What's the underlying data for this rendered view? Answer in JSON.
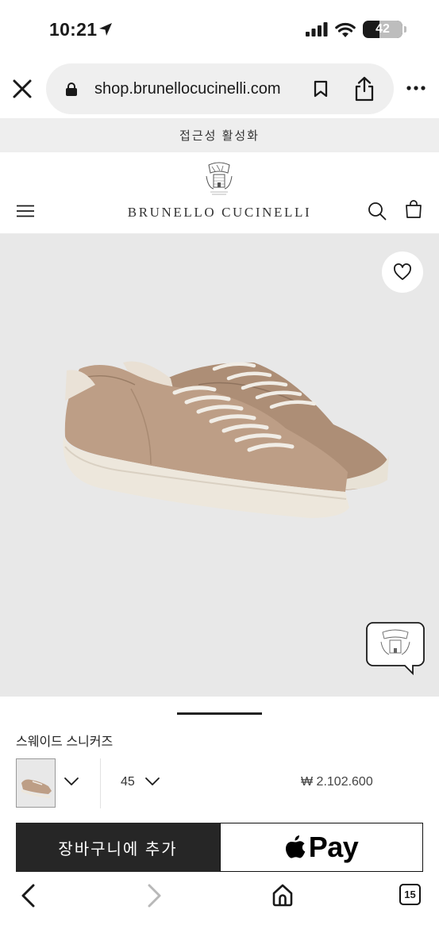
{
  "status_bar": {
    "time": "10:21",
    "battery": "42",
    "battery_level": 0.42
  },
  "browser": {
    "url": "shop.brunellocucinelli.com",
    "open_tabs": "15"
  },
  "site": {
    "accessibility_label": "접근성 활성화",
    "brand_name": "BRUNELLO CUCINELLI"
  },
  "product": {
    "name": "스웨이드 스니커즈",
    "size": "45",
    "price": "₩ 2.102.600",
    "add_to_cart_label": "장바구니에 추가",
    "apple_pay_label": "Pay",
    "image_color": "#b99b82"
  },
  "icons": {
    "close": "close-icon",
    "lock": "lock-icon",
    "bookmark": "bookmark-icon",
    "share": "share-icon",
    "more": "more-icon",
    "menu": "menu-icon",
    "search": "search-icon",
    "bag": "bag-icon",
    "wishlist": "heart-icon",
    "chat": "chat-icon",
    "back": "chevron-left-icon",
    "forward": "chevron-right-icon",
    "home": "home-icon",
    "tabs": "tabs-icon"
  }
}
